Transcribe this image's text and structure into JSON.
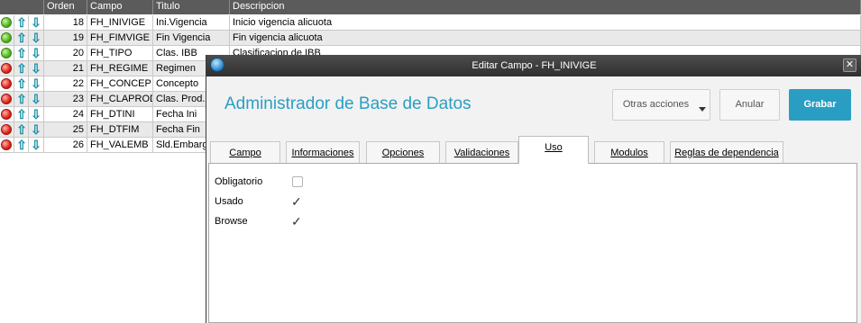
{
  "grid": {
    "headers": [
      "Orden",
      "Campo",
      "Titulo",
      "Descripcion"
    ],
    "rows": [
      {
        "status": "green",
        "order": "18",
        "field": "FH_INIVIGE",
        "title": "Ini.Vigencia",
        "desc": "Inicio vigencia alicuota"
      },
      {
        "status": "green",
        "order": "19",
        "field": "FH_FIMVIGE",
        "title": "Fin Vigencia",
        "desc": "Fin vigencia alicuota"
      },
      {
        "status": "green",
        "order": "20",
        "field": "FH_TIPO",
        "title": "Clas. IBB",
        "desc": "Clasificacion de IBB"
      },
      {
        "status": "red",
        "order": "21",
        "field": "FH_REGIME",
        "title": "Regimen",
        "desc": ""
      },
      {
        "status": "red",
        "order": "22",
        "field": "FH_CONCEP",
        "title": "Concepto",
        "desc": ""
      },
      {
        "status": "red",
        "order": "23",
        "field": "FH_CLAPROD",
        "title": "Clas. Prod.",
        "desc": ""
      },
      {
        "status": "red",
        "order": "24",
        "field": "FH_DTINI",
        "title": "Fecha Ini",
        "desc": ""
      },
      {
        "status": "red",
        "order": "25",
        "field": "FH_DTFIM",
        "title": "Fecha Fin",
        "desc": ""
      },
      {
        "status": "red",
        "order": "26",
        "field": "FH_VALEMB",
        "title": "Sld.Embarg",
        "desc": ""
      }
    ],
    "arrow_up": "⇧",
    "arrow_down": "⇩"
  },
  "dialog": {
    "title": "Editar Campo - FH_INIVIGE",
    "close_glyph": "✕",
    "app_title": "Administrador de Base de Datos",
    "buttons": {
      "other": "Otras acciones",
      "cancel": "Anular",
      "save": "Grabar"
    },
    "tabs": [
      "Campo",
      "Informaciones",
      "Opciones",
      "Validaciones",
      "Uso",
      "Modulos",
      "Reglas de dependencia"
    ],
    "active_tab": "Uso",
    "options": [
      {
        "label": "Obligatorio",
        "checked": false
      },
      {
        "label": "Usado",
        "checked": true
      },
      {
        "label": "Browse",
        "checked": true
      }
    ],
    "check_glyph": "✓"
  },
  "colors": {
    "accent": "#2a9ec2",
    "green_status": "#4db61d",
    "red_status": "#e0251a",
    "titlebar": "#3a3a3a"
  }
}
